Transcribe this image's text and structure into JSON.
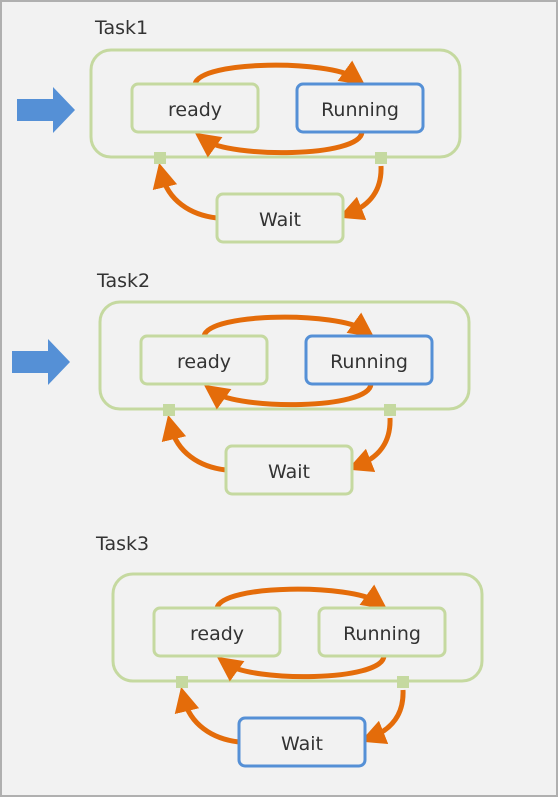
{
  "colors": {
    "idle_border": "#c5d9a0",
    "active_border": "#5590d6",
    "transition": "#e46c0a",
    "pointer": "#5590d6",
    "background": "#f2f2f2"
  },
  "tasks": [
    {
      "title": "Task1",
      "states": {
        "ready": "ready",
        "running": "Running",
        "wait": "Wait"
      },
      "active_state": "running",
      "pointer": true
    },
    {
      "title": "Task2",
      "states": {
        "ready": "ready",
        "running": "Running",
        "wait": "Wait"
      },
      "active_state": "running",
      "pointer": true
    },
    {
      "title": "Task3",
      "states": {
        "ready": "ready",
        "running": "Running",
        "wait": "Wait"
      },
      "active_state": "wait",
      "pointer": false
    }
  ]
}
